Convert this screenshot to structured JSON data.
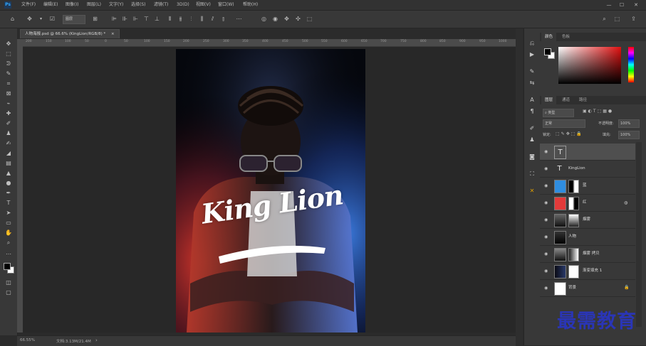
{
  "menu": {
    "logo": "Ps",
    "items": [
      "文件(F)",
      "编辑(E)",
      "图像(I)",
      "图层(L)",
      "文字(Y)",
      "选择(S)",
      "滤镜(T)",
      "3D(D)",
      "视图(V)",
      "窗口(W)",
      "帮助(H)"
    ],
    "win_min": "—",
    "win_max": "☐",
    "win_close": "✕"
  },
  "options": {
    "auto_select": "图层",
    "home_icon": "⌂",
    "move_icon": "✥",
    "search_icon": "⌕",
    "share_icon": "⬚"
  },
  "document": {
    "tab_label": "人物海报.psd @ 66.6% (KingLion/RGB/8) *",
    "tab_close": "×"
  },
  "ruler": {
    "numbers": [
      "200",
      "150",
      "100",
      "50",
      "0",
      "50",
      "100",
      "150",
      "200",
      "250",
      "300",
      "350",
      "400",
      "450",
      "500",
      "550",
      "600",
      "650",
      "700",
      "750",
      "800",
      "850",
      "900",
      "950",
      "1000"
    ]
  },
  "poster": {
    "headline": "King Lion"
  },
  "status": {
    "zoom": "66.55%",
    "doc": "文档:3.13M/21.4M",
    "arrow": "›"
  },
  "panels": {
    "color_tabs": [
      "颜色",
      "色板"
    ],
    "layers_tabs": [
      "图层",
      "通道",
      "路径"
    ],
    "kind_label": "类型",
    "blend_mode": "正常",
    "opacity_label": "不透明度:",
    "opacity_value": "100%",
    "lock_label": "锁定:",
    "fill_label": "填充:",
    "fill_value": "100%",
    "layers": [
      {
        "name": "",
        "type": "text",
        "selected": true
      },
      {
        "name": "KingLion",
        "type": "text",
        "selected": false
      },
      {
        "name": "蓝",
        "type": "fill",
        "color": "#2f8de0",
        "selected": false
      },
      {
        "name": "红",
        "type": "fill",
        "color": "#e23a3a",
        "selected": false
      },
      {
        "name": "烟雾",
        "type": "image",
        "selected": false
      },
      {
        "name": "人物",
        "type": "image",
        "selected": false
      },
      {
        "name": "烟雾 拷贝",
        "type": "image",
        "selected": false
      },
      {
        "name": "渐变填充 1",
        "type": "gradient",
        "selected": false
      },
      {
        "name": "背景",
        "type": "background",
        "selected": false
      }
    ]
  },
  "colors": {
    "accent": "#31a8ff",
    "watermark": "#2a35b6",
    "fg_swatch": "#000000",
    "bg_swatch": "#ffffff"
  },
  "watermark": "最需教育"
}
